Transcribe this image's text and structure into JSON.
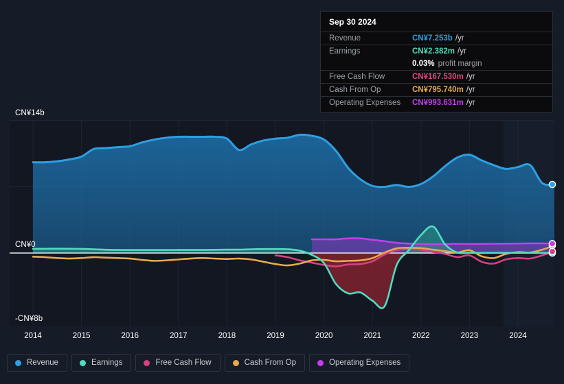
{
  "theme": {
    "background": "#161c27",
    "plot_background": "#121722",
    "zero_line": "#f2f4f7",
    "grid_line": "#2b3545",
    "axis_text": "#ffffff",
    "legend_text": "#c9ccd1",
    "legend_border": "#2f3441",
    "tooltip_background": "#0b0b0d",
    "tooltip_border": "#2a2d35",
    "tooltip_label": "#9aa0a6",
    "forecast_band": "#1b2433"
  },
  "tooltip": {
    "date": "Sep 30 2024",
    "rows": [
      {
        "label": "Revenue",
        "value": "CN¥7.253b",
        "unit": "/yr",
        "color": "#2e9fe0"
      },
      {
        "label": "Earnings",
        "value": "CN¥2.382m",
        "unit": "/yr",
        "color": "#4fddc0"
      },
      {
        "label": "",
        "value": "0.03%",
        "unit": "profit margin",
        "color": "#ffffff",
        "sub": true
      },
      {
        "label": "Free Cash Flow",
        "value": "CN¥167.530m",
        "unit": "/yr",
        "color": "#e0457f"
      },
      {
        "label": "Cash From Op",
        "value": "CN¥795.740m",
        "unit": "/yr",
        "color": "#e8aa4e"
      },
      {
        "label": "Operating Expenses",
        "value": "CN¥993.631m",
        "unit": "/yr",
        "color": "#c040e8"
      }
    ]
  },
  "legend": {
    "items": [
      {
        "label": "Revenue",
        "color": "#2e9fe0"
      },
      {
        "label": "Earnings",
        "color": "#4fddc0"
      },
      {
        "label": "Free Cash Flow",
        "color": "#d6417f"
      },
      {
        "label": "Cash From Op",
        "color": "#e8aa4e"
      },
      {
        "label": "Operating Expenses",
        "color": "#c040e8"
      }
    ]
  },
  "axes": {
    "y_labels": {
      "top": "CN¥14b",
      "zero": "CN¥0",
      "bottom": "-CN¥8b"
    },
    "x_labels": [
      "2014",
      "2015",
      "2016",
      "2017",
      "2018",
      "2019",
      "2020",
      "2021",
      "2022",
      "2023",
      "2024"
    ]
  },
  "chart_data": {
    "type": "area",
    "title": "",
    "subtitle": "",
    "xlabel": "",
    "ylabel": "CN¥",
    "currency": "CN¥",
    "unit": "billions",
    "ylim": [
      -8,
      14
    ],
    "y_ticks": [
      14,
      0,
      -8
    ],
    "y_tick_labels": [
      "CN¥14b",
      "CN¥0",
      "-CN¥8b"
    ],
    "xlim": [
      "2014",
      "2024.75"
    ],
    "x_ticks": [
      "2014",
      "2015",
      "2016",
      "2017",
      "2018",
      "2019",
      "2020",
      "2021",
      "2022",
      "2023",
      "2024"
    ],
    "grid": true,
    "legend_position": "bottom",
    "x": [
      2014.0,
      2014.25,
      2014.5,
      2014.75,
      2015.0,
      2015.25,
      2015.5,
      2015.75,
      2016.0,
      2016.25,
      2016.5,
      2016.75,
      2017.0,
      2017.25,
      2017.5,
      2017.75,
      2018.0,
      2018.25,
      2018.5,
      2018.75,
      2019.0,
      2019.25,
      2019.5,
      2019.75,
      2020.0,
      2020.25,
      2020.5,
      2020.75,
      2021.0,
      2021.25,
      2021.5,
      2021.75,
      2022.0,
      2022.25,
      2022.5,
      2022.75,
      2023.0,
      2023.25,
      2023.5,
      2023.75,
      2024.0,
      2024.25,
      2024.5,
      2024.75
    ],
    "series": [
      {
        "name": "Revenue",
        "color": "#2e9fe0",
        "filled": true,
        "values": [
          9.6,
          9.6,
          9.7,
          9.9,
          10.2,
          11.0,
          11.1,
          11.2,
          11.3,
          11.7,
          12.0,
          12.2,
          12.3,
          12.3,
          12.3,
          12.3,
          12.1,
          10.9,
          11.5,
          11.9,
          12.1,
          12.2,
          12.5,
          12.4,
          12.0,
          10.8,
          9.0,
          7.8,
          7.1,
          7.0,
          7.2,
          7.0,
          7.3,
          8.1,
          9.2,
          10.1,
          10.4,
          9.8,
          9.3,
          8.9,
          9.1,
          9.3,
          7.4,
          7.253
        ]
      },
      {
        "name": "Earnings",
        "color": "#4fddc0",
        "filled": true,
        "values": [
          0.45,
          0.45,
          0.46,
          0.45,
          0.44,
          0.4,
          0.35,
          0.33,
          0.32,
          0.32,
          0.32,
          0.32,
          0.33,
          0.33,
          0.33,
          0.34,
          0.36,
          0.36,
          0.4,
          0.42,
          0.42,
          0.4,
          0.25,
          -0.2,
          -1.1,
          -3.4,
          -4.4,
          -4.3,
          -5.2,
          -5.8,
          -1.3,
          0.3,
          1.9,
          2.8,
          0.9,
          0.05,
          0.02,
          0.01,
          0.02,
          0.02,
          0.02,
          0.02,
          0.01,
          0.002382
        ]
      },
      {
        "name": "Free Cash Flow",
        "color": "#d6417f",
        "filled": false,
        "values": [
          null,
          null,
          null,
          null,
          null,
          null,
          null,
          null,
          null,
          null,
          null,
          null,
          null,
          null,
          null,
          null,
          null,
          null,
          null,
          null,
          -0.25,
          -0.45,
          -0.8,
          -1.05,
          -1.3,
          -1.45,
          -1.25,
          -1.2,
          -0.9,
          -0.15,
          0.32,
          0.38,
          0.35,
          0.1,
          -0.1,
          -0.45,
          -0.25,
          -0.95,
          -1.15,
          -0.7,
          -0.55,
          -0.6,
          -0.25,
          0.16753
        ]
      },
      {
        "name": "Cash From Op",
        "color": "#e8aa4e",
        "filled": false,
        "values": [
          -0.4,
          -0.45,
          -0.55,
          -0.6,
          -0.55,
          -0.45,
          -0.5,
          -0.55,
          -0.6,
          -0.75,
          -0.85,
          -0.8,
          -0.7,
          -0.6,
          -0.55,
          -0.6,
          -0.65,
          -0.6,
          -0.7,
          -0.95,
          -1.2,
          -1.35,
          -1.15,
          -0.8,
          -0.75,
          -0.9,
          -0.85,
          -0.8,
          -0.55,
          0.05,
          0.5,
          0.55,
          0.52,
          0.35,
          0.2,
          0.05,
          0.3,
          -0.35,
          -0.55,
          -0.1,
          0.1,
          0.05,
          0.35,
          0.79574
        ]
      },
      {
        "name": "Operating Expenses",
        "color": "#c040e8",
        "filled": true,
        "values": [
          null,
          null,
          null,
          null,
          null,
          null,
          null,
          null,
          null,
          null,
          null,
          null,
          null,
          null,
          null,
          null,
          null,
          null,
          null,
          null,
          null,
          null,
          null,
          1.45,
          1.45,
          1.45,
          1.55,
          1.55,
          1.4,
          1.25,
          1.08,
          1.0,
          0.96,
          0.94,
          0.95,
          0.98,
          0.96,
          0.97,
          0.98,
          0.99,
          1.0,
          1.02,
          1.02,
          0.993631
        ]
      }
    ],
    "endpoint_markers": [
      {
        "series": "Revenue",
        "value": 7.253,
        "color": "#2e9fe0"
      },
      {
        "series": "Earnings",
        "value": 0.002382,
        "color": "#4fddc0"
      },
      {
        "series": "Free Cash Flow",
        "value": 0.16753,
        "color": "#d6417f"
      },
      {
        "series": "Cash From Op",
        "value": 0.79574,
        "color": "#e8aa4e"
      },
      {
        "series": "Operating Expenses",
        "value": 0.993631,
        "color": "#c040e8"
      }
    ],
    "forecast_band": {
      "start_x": 2023.7,
      "end_x": 2024.75
    }
  }
}
